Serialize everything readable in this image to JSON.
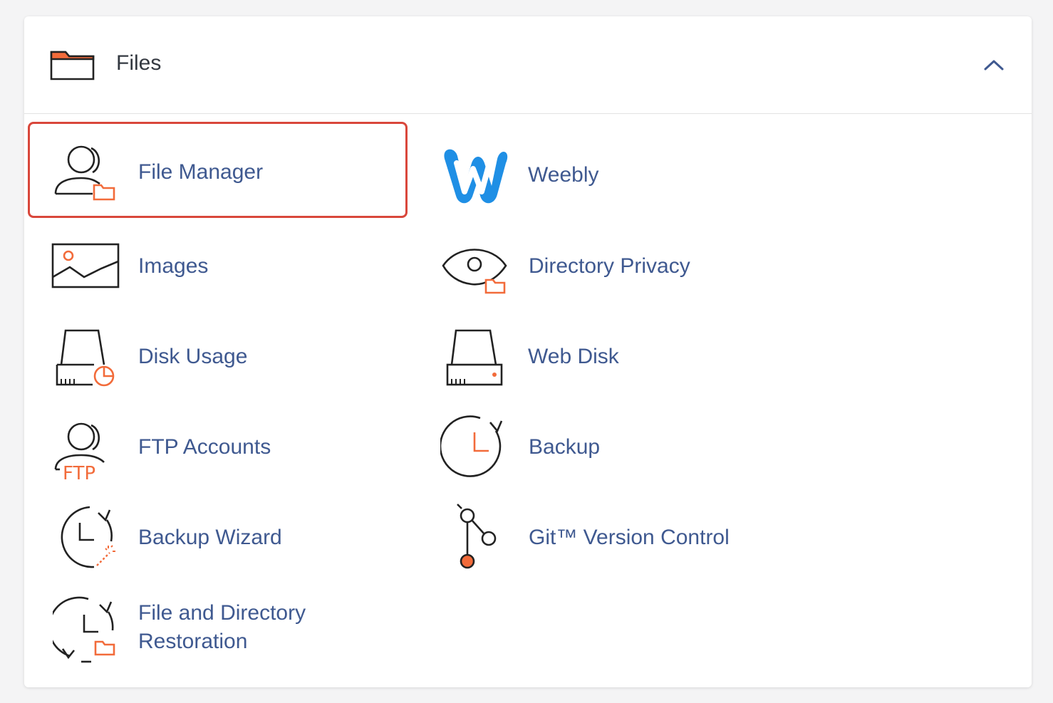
{
  "section": {
    "title": "Files",
    "icon": "folder-icon",
    "collapse_icon": "chevron-up-icon"
  },
  "colors": {
    "link": "#3f5990",
    "accent_orange": "#f26b3a",
    "highlight_border": "#d9473b",
    "weebly_blue": "#1f8fe5"
  },
  "items": [
    {
      "label": "File Manager",
      "icon": "file-manager-icon",
      "highlighted": true
    },
    {
      "label": "Weebly",
      "icon": "weebly-logo-icon"
    },
    {
      "label": "Images",
      "icon": "image-icon"
    },
    {
      "label": "Directory Privacy",
      "icon": "eye-folder-icon"
    },
    {
      "label": "Disk Usage",
      "icon": "disk-usage-icon"
    },
    {
      "label": "Web Disk",
      "icon": "web-disk-icon"
    },
    {
      "label": "FTP Accounts",
      "icon": "ftp-user-icon",
      "icon_text": "FTP"
    },
    {
      "label": "Backup",
      "icon": "backup-clock-icon"
    },
    {
      "label": "Backup Wizard",
      "icon": "backup-wizard-icon"
    },
    {
      "label": "Git™ Version Control",
      "icon": "git-branch-icon"
    },
    {
      "label_line1": "File and Directory",
      "label_line2": "Restoration",
      "icon": "restore-icon"
    }
  ]
}
